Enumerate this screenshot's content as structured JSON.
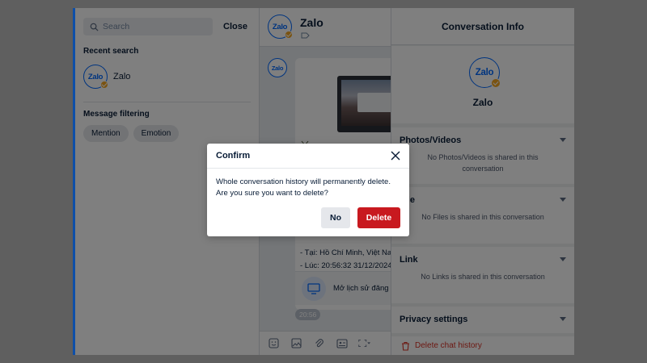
{
  "search": {
    "placeholder": "Search",
    "close_label": "Close",
    "recent_title": "Recent search",
    "recent_items": [
      {
        "name": "Zalo"
      }
    ],
    "filter_title": "Message filtering",
    "filters": [
      "Mention",
      "Emotion"
    ]
  },
  "chat": {
    "name": "Zalo",
    "avatar_text": "Zalo",
    "message_lines": [
      "- Tại: Hồ Chí Minh, Việt Nam",
      "- Lúc: 20:56:32 31/12/2024"
    ],
    "history_text": "Mở lịch sử đăng n",
    "time": "20:56"
  },
  "info": {
    "title": "Conversation Info",
    "name": "Zalo",
    "sections": [
      {
        "title": "Photos/Videos",
        "empty": "No Photos/Videos is shared in this conversation"
      },
      {
        "title": "File",
        "empty": "No Files is shared in this conversation"
      },
      {
        "title": "Link",
        "empty": "No Links is shared in this conversation"
      },
      {
        "title": "Privacy settings",
        "empty": ""
      }
    ],
    "delete_label": "Delete chat history"
  },
  "dialog": {
    "title": "Confirm",
    "line1": "Whole conversation history will permanently delete.",
    "line2": "Are you sure you want to delete?",
    "no_label": "No",
    "delete_label": "Delete"
  },
  "colors": {
    "brand": "#0068ff",
    "danger": "#c8191f",
    "badge": "#f5a623"
  }
}
